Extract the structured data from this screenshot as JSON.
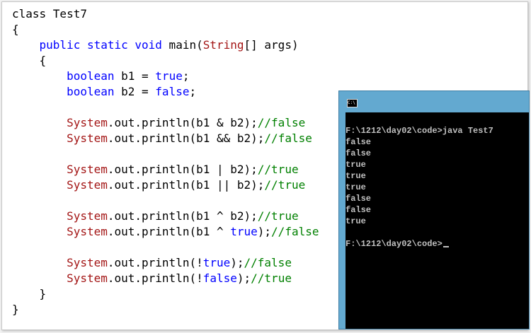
{
  "code_editor": {
    "lines": [
      [
        {
          "t": "class Test7",
          "c": ""
        }
      ],
      [
        {
          "t": "{",
          "c": ""
        }
      ],
      [
        {
          "t": "    ",
          "c": ""
        },
        {
          "t": "public static void",
          "c": "kw"
        },
        {
          "t": " main(",
          "c": ""
        },
        {
          "t": "String",
          "c": "cls"
        },
        {
          "t": "[] args)",
          "c": ""
        }
      ],
      [
        {
          "t": "    {",
          "c": ""
        }
      ],
      [
        {
          "t": "        ",
          "c": ""
        },
        {
          "t": "boolean",
          "c": "kw"
        },
        {
          "t": " b1 = ",
          "c": ""
        },
        {
          "t": "true",
          "c": "kw"
        },
        {
          "t": ";",
          "c": ""
        }
      ],
      [
        {
          "t": "        ",
          "c": ""
        },
        {
          "t": "boolean",
          "c": "kw"
        },
        {
          "t": " b2 = ",
          "c": ""
        },
        {
          "t": "false",
          "c": "kw"
        },
        {
          "t": ";",
          "c": ""
        }
      ],
      [],
      [
        {
          "t": "        ",
          "c": ""
        },
        {
          "t": "System",
          "c": "cls"
        },
        {
          "t": ".out.println(b1 & b2);",
          "c": ""
        },
        {
          "t": "//false",
          "c": "cmt"
        }
      ],
      [
        {
          "t": "        ",
          "c": ""
        },
        {
          "t": "System",
          "c": "cls"
        },
        {
          "t": ".out.println(b1 && b2);",
          "c": ""
        },
        {
          "t": "//false",
          "c": "cmt"
        }
      ],
      [],
      [
        {
          "t": "        ",
          "c": ""
        },
        {
          "t": "System",
          "c": "cls"
        },
        {
          "t": ".out.println(b1 | b2);",
          "c": ""
        },
        {
          "t": "//true",
          "c": "cmt"
        }
      ],
      [
        {
          "t": "        ",
          "c": ""
        },
        {
          "t": "System",
          "c": "cls"
        },
        {
          "t": ".out.println(b1 || b2);",
          "c": ""
        },
        {
          "t": "//true",
          "c": "cmt"
        }
      ],
      [],
      [
        {
          "t": "        ",
          "c": ""
        },
        {
          "t": "System",
          "c": "cls"
        },
        {
          "t": ".out.println(b1 ^ b2);",
          "c": ""
        },
        {
          "t": "//true",
          "c": "cmt"
        }
      ],
      [
        {
          "t": "        ",
          "c": ""
        },
        {
          "t": "System",
          "c": "cls"
        },
        {
          "t": ".out.println(b1 ^ ",
          "c": ""
        },
        {
          "t": "true",
          "c": "kw"
        },
        {
          "t": ");",
          "c": ""
        },
        {
          "t": "//false",
          "c": "cmt"
        }
      ],
      [],
      [
        {
          "t": "        ",
          "c": ""
        },
        {
          "t": "System",
          "c": "cls"
        },
        {
          "t": ".out.println(!",
          "c": ""
        },
        {
          "t": "true",
          "c": "kw"
        },
        {
          "t": ");",
          "c": ""
        },
        {
          "t": "//false",
          "c": "cmt"
        }
      ],
      [
        {
          "t": "        ",
          "c": ""
        },
        {
          "t": "System",
          "c": "cls"
        },
        {
          "t": ".out.println(!",
          "c": ""
        },
        {
          "t": "false",
          "c": "kw"
        },
        {
          "t": ");",
          "c": ""
        },
        {
          "t": "//true",
          "c": "cmt"
        }
      ],
      [
        {
          "t": "    }",
          "c": ""
        }
      ],
      [
        {
          "t": "}",
          "c": ""
        }
      ]
    ]
  },
  "console": {
    "title_icon_text": "C:\\",
    "lines": [
      "F:\\1212\\day02\\code>java Test7",
      "false",
      "false",
      "true",
      "true",
      "true",
      "false",
      "false",
      "true",
      "",
      "F:\\1212\\day02\\code>"
    ]
  },
  "colors": {
    "keyword": "#0000ff",
    "class_name": "#a31515",
    "comment": "#008000",
    "console_titlebar": "#63a9d0",
    "console_background": "#000000",
    "console_text": "#c0c0c0"
  }
}
